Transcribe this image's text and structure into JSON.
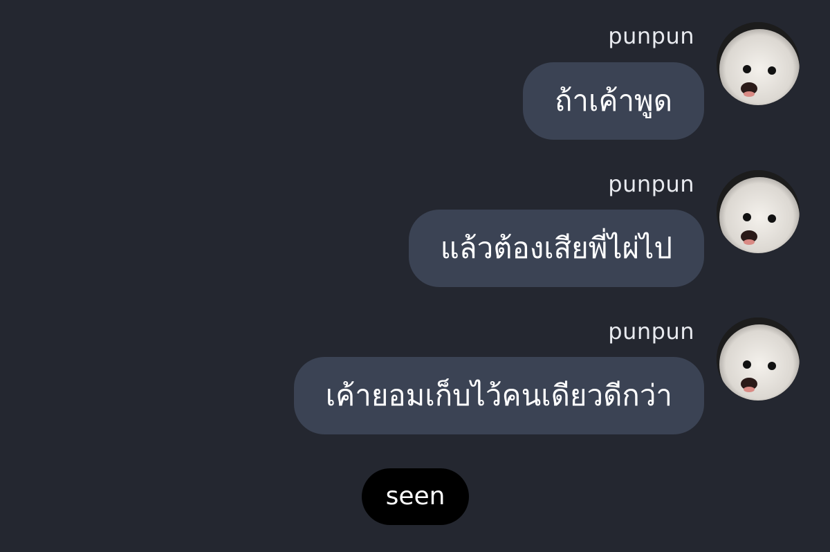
{
  "chat": {
    "messages": [
      {
        "sender": "punpun",
        "text": "ถ้าเค้าพูด",
        "avatar_icon": "dog-avatar-icon"
      },
      {
        "sender": "punpun",
        "text": "แล้วต้องเสียพี่ไผ่ไป",
        "avatar_icon": "dog-avatar-icon"
      },
      {
        "sender": "punpun",
        "text": "เค้ายอมเก็บไว้คนเดียวดีกว่า",
        "avatar_icon": "dog-avatar-icon"
      }
    ],
    "seen_label": "seen"
  },
  "colors": {
    "background": "#242730",
    "bubble": "#3b4354",
    "seen_badge": "#000000",
    "text": "#ffffff"
  }
}
